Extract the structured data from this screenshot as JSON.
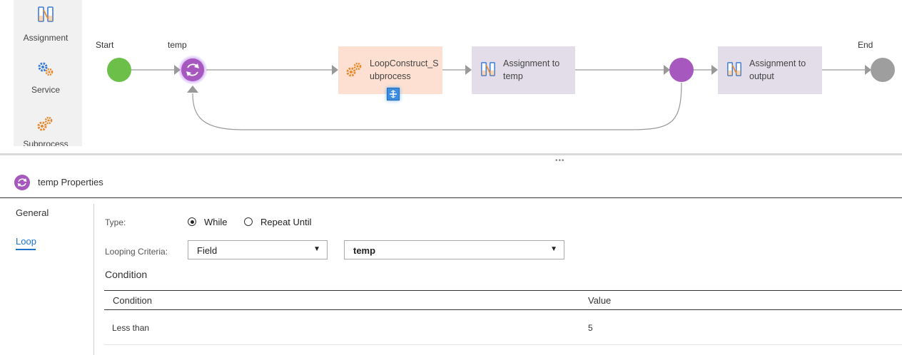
{
  "palette": {
    "items": [
      {
        "label": "Assignment",
        "icon": "assignment-icon"
      },
      {
        "label": "Service",
        "icon": "service-gears-icon"
      },
      {
        "label": "Subprocess",
        "icon": "subprocess-gears-icon"
      }
    ]
  },
  "canvas": {
    "start_label": "Start",
    "temp_label": "temp",
    "end_label": "End",
    "subprocess_node": {
      "line1": "LoopConstruct_S",
      "line2": "ubprocess"
    },
    "assign_temp_node": {
      "line1": "Assignment to",
      "line2": "temp"
    },
    "assign_output_node": {
      "line1": "Assignment to",
      "line2": "output"
    }
  },
  "properties": {
    "title": "temp Properties",
    "nav": {
      "general": "General",
      "loop": "Loop"
    },
    "type_label": "Type:",
    "type_options": [
      "While",
      "Repeat Until"
    ],
    "type_selected": "While",
    "criteria_label": "Looping Criteria:",
    "criteria_select": "Field",
    "criteria_field": "temp",
    "condition_section": "Condition",
    "table": {
      "headers": [
        "Condition",
        "Value"
      ],
      "rows": [
        {
          "condition": "Less than",
          "value": "5"
        }
      ]
    }
  },
  "colors": {
    "start": "#6cc04a",
    "loop_node": "#a658be",
    "end": "#9e9e9e",
    "subprocess_fill": "#fde0d1",
    "assignment_fill": "#e2dde9",
    "accent": "#1a73c8"
  }
}
